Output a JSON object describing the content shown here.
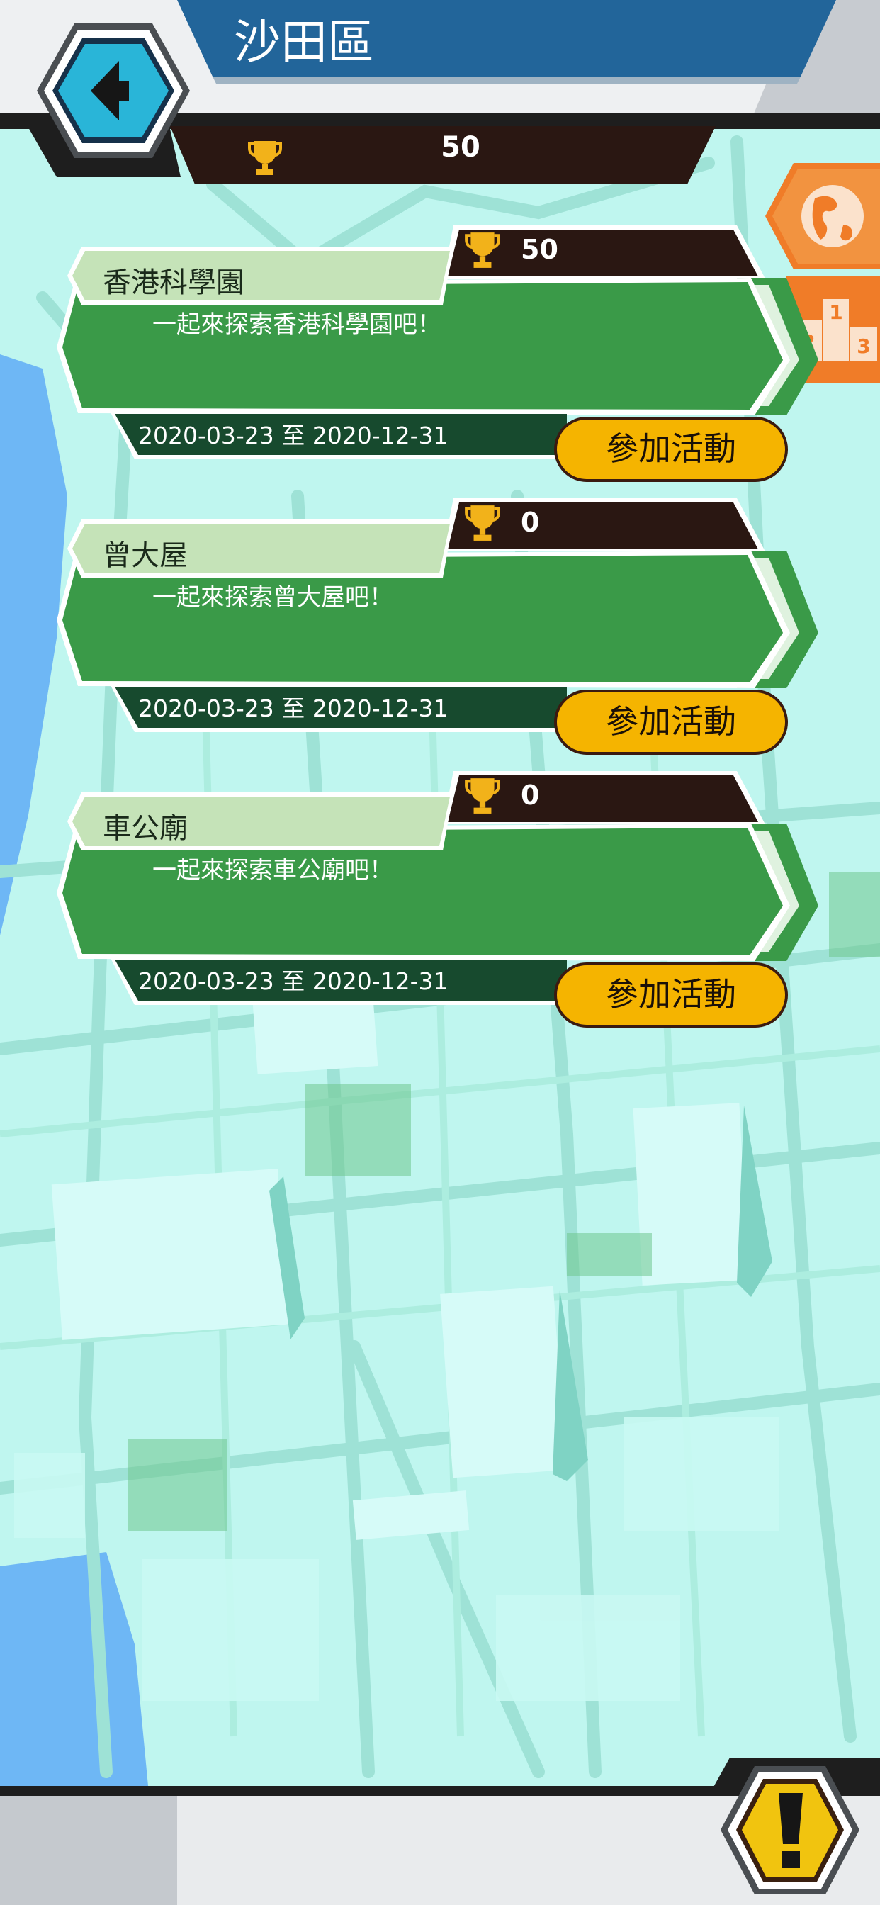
{
  "header": {
    "title": "沙田區",
    "score": "50"
  },
  "events": [
    {
      "title": "香港科學園",
      "description": "一起來探索香港科學園吧！",
      "points": "50",
      "date_range": "2020-03-23 至 2020-12-31",
      "button_label": "參加活動"
    },
    {
      "title": "曾大屋",
      "description": "一起來探索曾大屋吧！",
      "points": "0",
      "date_range": "2020-03-23 至 2020-12-31",
      "button_label": "參加活動"
    },
    {
      "title": "車公廟",
      "description": "一起來探索車公廟吧！",
      "points": "0",
      "date_range": "2020-03-23 至 2020-12-31",
      "button_label": "參加活動"
    }
  ],
  "icons": {
    "back": "arrow-left-icon",
    "trophy": "trophy-icon",
    "globe": "globe-icon",
    "ranking": "podium-icon",
    "alert": "exclamation-icon"
  },
  "colors": {
    "header_blue": "#22659a",
    "card_green": "#3a9a48",
    "card_dark_green": "#174a2e",
    "title_tab": "#c5e3b8",
    "points_bar": "#2a1712",
    "button_yellow": "#f5b400",
    "side_orange": "#f07c28",
    "back_cyan": "#29b5d8",
    "alert_yellow": "#f1c40f",
    "map_light": "#c4f7f0",
    "map_dark": "#9fe4da"
  }
}
